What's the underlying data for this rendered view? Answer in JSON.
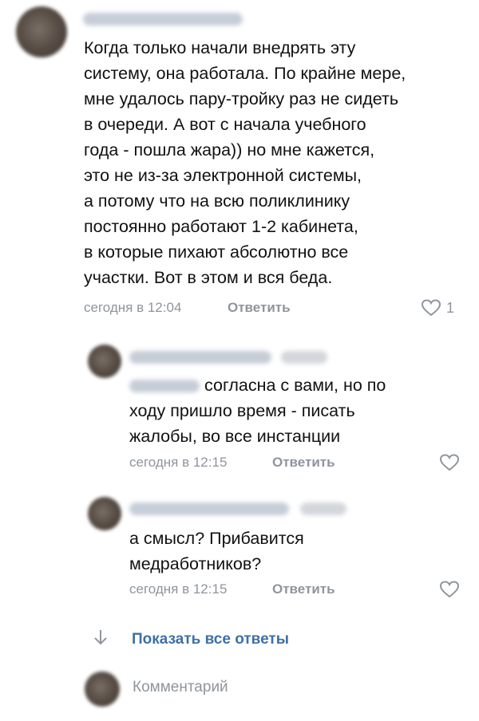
{
  "comments": [
    {
      "text": "Когда только начали внедрять эту\nсистему, она работала. По крайне мере,\nмне удалось пару-тройку раз не сидеть\nв очереди. А вот с начала учебного\nгода - пошла жара)) но мне кажется,\nэто не из-за электронной системы,\nа потому что на всю поликлинику\nпостоянно работают 1-2 кабинета,\nв которые пихают абсолютно все\nучастки. Вот в этом и вся беда.",
      "time": "сегодня в 12:04",
      "reply_label": "Ответить",
      "like_count": "1"
    },
    {
      "text": "согласна с вами, но по\nходу пришло время - писать\nжалобы, во все инстанции",
      "time": "сегодня в 12:15",
      "reply_label": "Ответить"
    },
    {
      "text": "а смысл? Прибавится\nмедработников?",
      "time": "сегодня в 12:15",
      "reply_label": "Ответить"
    }
  ],
  "show_all_label": "Показать все ответы",
  "comment_input": {
    "placeholder": "Комментарий"
  },
  "colors": {
    "link": "#3f6fa6",
    "meta": "#8f959c",
    "text": "#111111"
  },
  "icons": {
    "like": "heart-icon",
    "show_all": "arrow-down-icon"
  }
}
